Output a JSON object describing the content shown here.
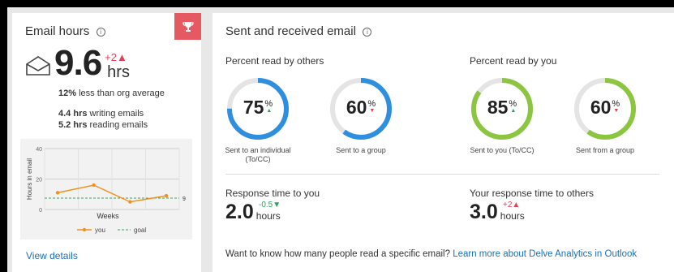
{
  "email_hours": {
    "title": "Email hours",
    "value": "9.6",
    "unit": "hrs",
    "delta": "+2▲",
    "comparison_bold": "12%",
    "comparison_text": "less than org average",
    "writing_bold": "4.4 hrs",
    "writing_text": "writing emails",
    "reading_bold": "5.2 hrs",
    "reading_text": "reading emails",
    "view_details": "View details",
    "icons": {
      "trophy": "trophy-icon",
      "envelope": "envelope-open-icon",
      "info": "info-icon"
    }
  },
  "chart_data": {
    "type": "line",
    "xlabel": "Weeks",
    "ylabel": "Hours in email",
    "ylim": [
      0,
      40
    ],
    "yticks": [
      0,
      20,
      40
    ],
    "grid": true,
    "series": [
      {
        "name": "you",
        "values": [
          11,
          16,
          5,
          9
        ],
        "color": "#f0921e"
      }
    ],
    "goal": {
      "name": "goal",
      "value": 7.5,
      "label": "9",
      "color": "#3ca35a"
    },
    "legend_position": "bottom"
  },
  "sent_received": {
    "title": "Sent and received email",
    "read_by_others_label": "Percent read by others",
    "read_by_you_label": "Percent read by you",
    "rings": [
      {
        "value": "75",
        "unit": "%",
        "arrow": "▲",
        "arrow_color": "#2ea15f",
        "pct": 0.75,
        "color": "#2e8fde",
        "caption": "Sent to an individual (To/CC)"
      },
      {
        "value": "60",
        "unit": "%",
        "arrow": "▼",
        "arrow_color": "#e0405a",
        "pct": 0.6,
        "color": "#2e8fde",
        "caption": "Sent to a group"
      },
      {
        "value": "85",
        "unit": "%",
        "arrow": "▲",
        "arrow_color": "#2ea15f",
        "pct": 0.85,
        "color": "#8cc53f",
        "caption": "Sent to you (To/CC)"
      },
      {
        "value": "60",
        "unit": "%",
        "arrow": "▼",
        "arrow_color": "#e0405a",
        "pct": 0.6,
        "color": "#8cc53f",
        "caption": "Sent from a group"
      }
    ],
    "response_to_you": {
      "label": "Response time to you",
      "value": "2.0",
      "unit": "hours",
      "delta": "-0.5▼"
    },
    "response_to_others": {
      "label": "Your response time to others",
      "value": "3.0",
      "unit": "hours",
      "delta": "+2▲"
    },
    "footer_text": "Want to know how many people read a specific email?",
    "footer_link": "Learn more about Delve Analytics in Outlook"
  }
}
